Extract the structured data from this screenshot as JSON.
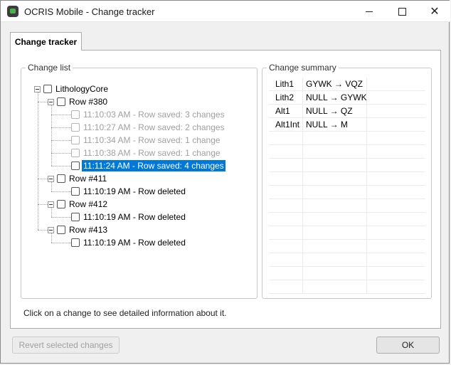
{
  "window": {
    "title": "OCRIS Mobile - Change tracker"
  },
  "tab": {
    "label": "Change tracker"
  },
  "change_list": {
    "legend": "Change list",
    "root": "LithologyCore",
    "rows": [
      {
        "label": "Row #380",
        "items": [
          {
            "label": "11:10:03 AM - Row saved: 3 changes",
            "state": "disabled"
          },
          {
            "label": "11:10:27 AM - Row saved: 2 changes",
            "state": "disabled"
          },
          {
            "label": "11:10:34 AM - Row saved: 1 change",
            "state": "disabled"
          },
          {
            "label": "11:10:38 AM - Row saved: 1 change",
            "state": "disabled"
          },
          {
            "label": "11:11:24 AM - Row saved: 4 changes",
            "state": "selected"
          }
        ]
      },
      {
        "label": "Row #411",
        "items": [
          {
            "label": "11:10:19 AM - Row deleted",
            "state": "normal"
          }
        ]
      },
      {
        "label": "Row #412",
        "items": [
          {
            "label": "11:10:19 AM - Row deleted",
            "state": "normal"
          }
        ]
      },
      {
        "label": "Row #413",
        "items": [
          {
            "label": "11:10:19 AM - Row deleted",
            "state": "normal"
          }
        ]
      }
    ]
  },
  "change_summary": {
    "legend": "Change summary",
    "rows": [
      {
        "field": "Lith1",
        "change": "GYWK → VQZ"
      },
      {
        "field": "Lith2",
        "change": "NULL → GYWK"
      },
      {
        "field": "Alt1",
        "change": "NULL → QZ"
      },
      {
        "field": "Alt1Int",
        "change": "NULL → M"
      }
    ]
  },
  "hint": "Click on a change to see detailed information about it.",
  "buttons": {
    "revert": "Revert selected changes",
    "ok": "OK"
  },
  "colors": {
    "selection": "#0078d7",
    "app_accent": "#4caf50"
  }
}
